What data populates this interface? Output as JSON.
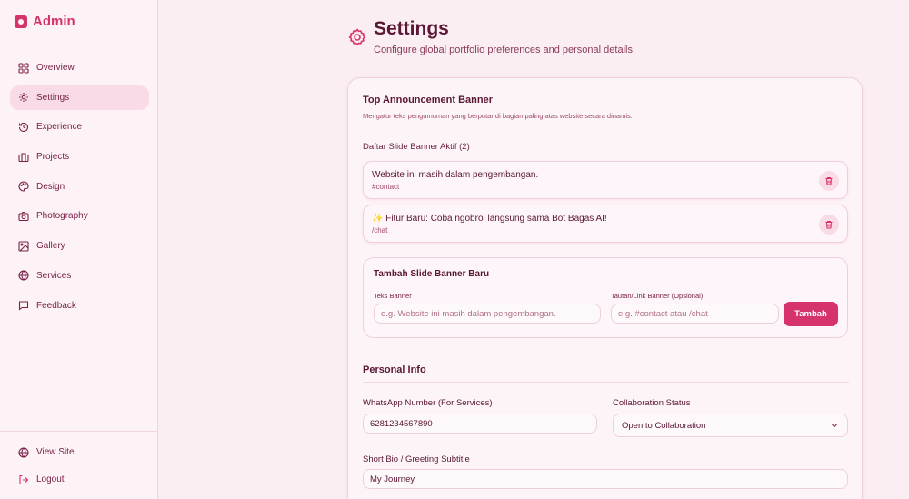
{
  "sidebar": {
    "brand": "Admin",
    "items": [
      {
        "label": "Overview",
        "icon": "grid-icon"
      },
      {
        "label": "Settings",
        "icon": "gear-icon"
      },
      {
        "label": "Experience",
        "icon": "history-icon"
      },
      {
        "label": "Projects",
        "icon": "briefcase-icon"
      },
      {
        "label": "Design",
        "icon": "palette-icon"
      },
      {
        "label": "Photography",
        "icon": "camera-icon"
      },
      {
        "label": "Gallery",
        "icon": "image-icon"
      },
      {
        "label": "Services",
        "icon": "globe-icon"
      },
      {
        "label": "Feedback",
        "icon": "message-icon"
      }
    ],
    "active_index": 1,
    "bottom": [
      {
        "label": "View Site",
        "icon": "globe-icon"
      },
      {
        "label": "Logout",
        "icon": "logout-icon"
      }
    ]
  },
  "header": {
    "title": "Settings",
    "subtitle": "Configure global portfolio preferences and personal details."
  },
  "banner": {
    "title": "Top Announcement Banner",
    "desc": "Mengatur teks pengumuman yang berputar di bagian paling atas website secara dinamis.",
    "list_label": "Daftar Slide Banner Aktif (2)",
    "slides": [
      {
        "text": "Website ini masih dalam pengembangan.",
        "link": "#contact"
      },
      {
        "text": "✨ Fitur Baru: Coba ngobrol langsung sama Bot Bagas AI!",
        "link": "/chat"
      }
    ],
    "add": {
      "title": "Tambah Slide Banner Baru",
      "text_label": "Teks Banner",
      "text_placeholder": "e.g. Website ini masih dalam pengembangan.",
      "link_label": "Tautan/Link Banner (Opsional)",
      "link_placeholder": "e.g. #contact atau /chat",
      "button": "Tambah"
    }
  },
  "personal": {
    "title": "Personal Info",
    "whatsapp_label": "WhatsApp Number (For Services)",
    "whatsapp_value": "6281234567890",
    "collab_label": "Collaboration Status",
    "collab_value": "Open to Collaboration",
    "bio_label": "Short Bio / Greeting Subtitle",
    "bio_value": "My Journey"
  },
  "colors": {
    "accent": "#d6336c",
    "background": "#fbeef3",
    "text": "#5a1634"
  }
}
